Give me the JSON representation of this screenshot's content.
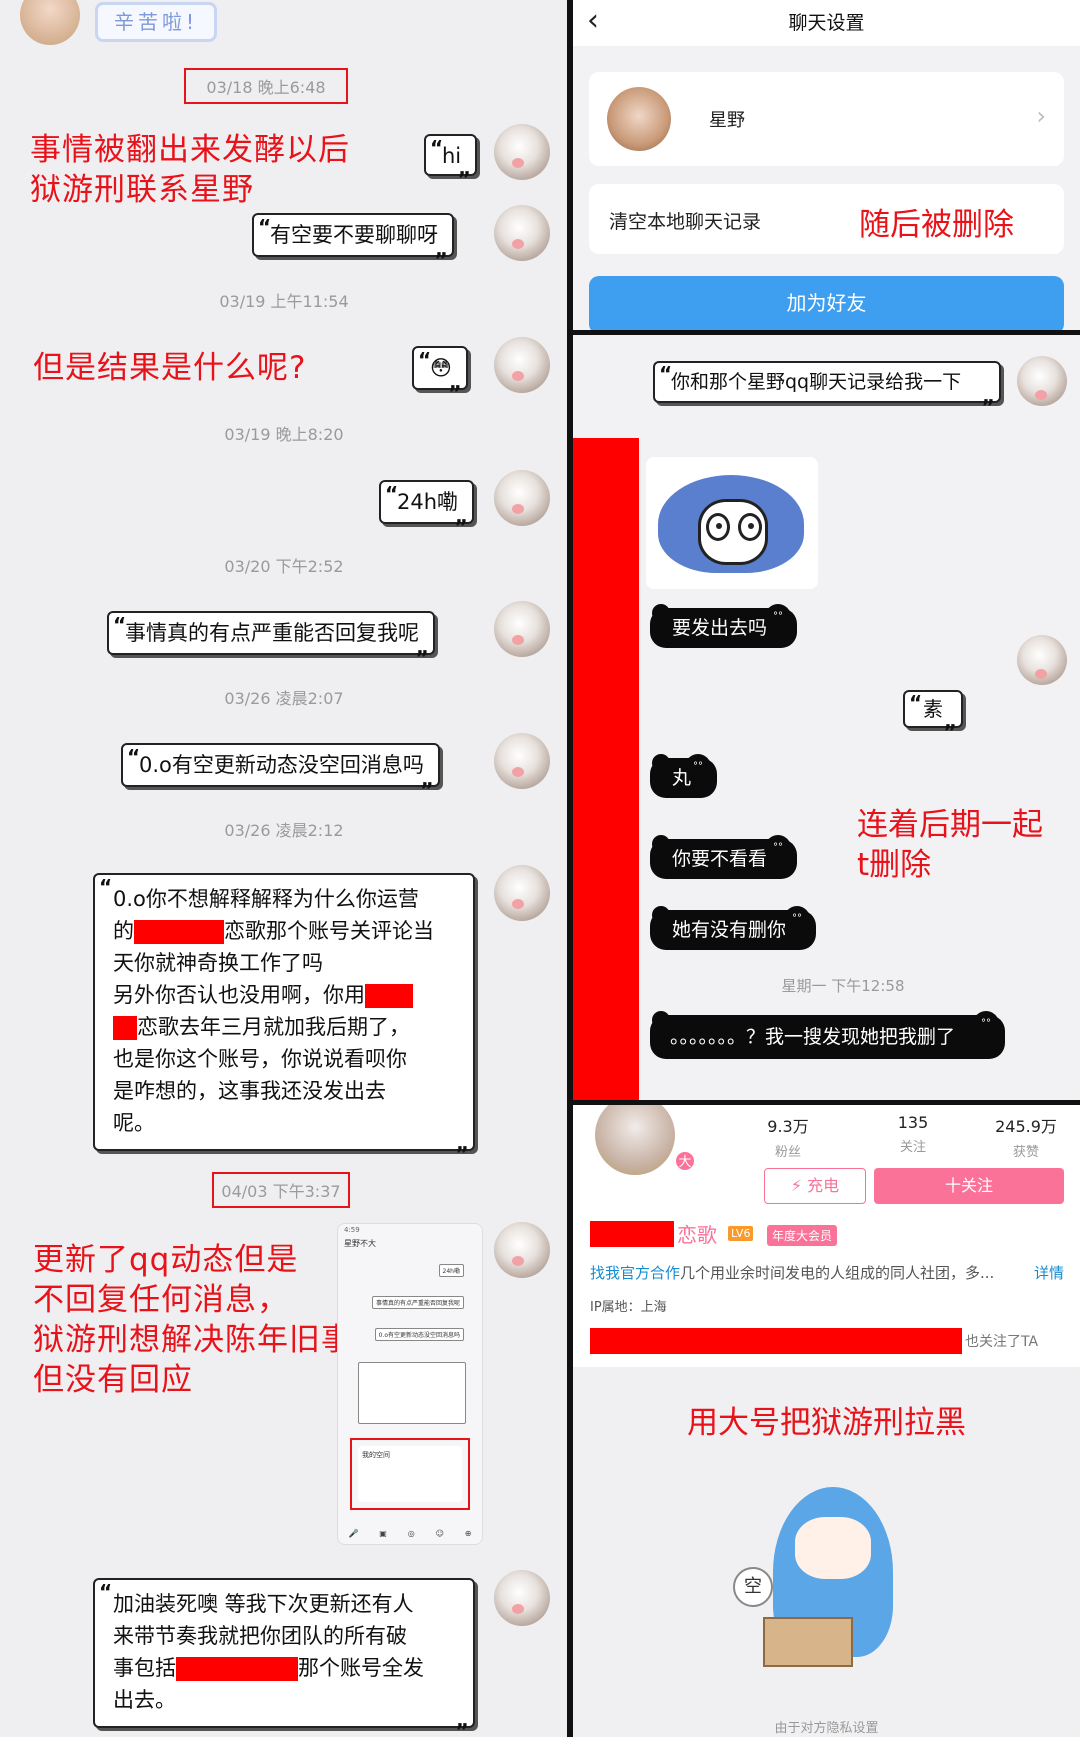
{
  "left": {
    "sticker_text": "辛苦啦!",
    "messages": [
      {
        "time": "03/18 晚上6:48",
        "bubbles": [
          "hi",
          "有空要不要聊聊呀"
        ],
        "note": "事情被翻出来发酵以后\n狱游刑联系星野"
      },
      {
        "time": "03/19 上午11:54",
        "bubbles": [
          "😳"
        ],
        "note": "但是结果是什么呢?"
      },
      {
        "time": "03/19 晚上8:20",
        "bubbles": [
          "24h嘞"
        ]
      },
      {
        "time": "03/20 下午2:52",
        "bubbles": [
          "事情真的有点严重能否回复我呢"
        ]
      },
      {
        "time": "03/26 凌晨2:07",
        "bubbles": [
          "0.o有空更新动态没空回消息吗"
        ]
      },
      {
        "time": "03/26 凌晨2:12",
        "long_bubble": {
          "line1": "0.o你不想解释解释为什么你运营",
          "line2a": "的",
          "line2b": "恋歌那个账号关评论当",
          "line3": "天你就神奇换工作了吗",
          "line4": "另外你否认也没用啊，你用",
          "line5": "恋歌去年三月就加我后期了，",
          "line6": "也是你这个账号，你说说看呗你",
          "line7": "是咋想的，这事我还没发出去",
          "line8": "呢。"
        }
      },
      {
        "time": "04/03 下午3:37",
        "note": "更新了qq动态但是\n不回复任何消息，\n狱游刑想解决陈年旧事\n但没有回应"
      }
    ],
    "last_bubble": {
      "line1": "加油装死噢 等我下次更新还有人",
      "line2": "来带节奏我就把你团队的所有破",
      "line3a": "事包括",
      "line3b": "那个账号全发",
      "line4": "出去。"
    },
    "mini_shot": {
      "status": "4:59",
      "title": "星野不大",
      "m1": "24h嘞",
      "m2": "事情真的有点严重能否回复我呢",
      "m3": "0.o有空更新动态没空回消息吗",
      "card": "我的空间"
    }
  },
  "settings": {
    "title": "聊天设置",
    "back_icon": "‹",
    "contact_name": "星野",
    "clear_history": "清空本地聊天记录",
    "annotation": "随后被删除",
    "add_friend": "加为好友"
  },
  "chat2": {
    "request": "你和那个星野qq聊天记录给我一下",
    "replies": [
      "要发出去吗",
      "丸",
      "你要不看看",
      "她有没有删你"
    ],
    "my_reply": "素",
    "time": "星期一 下午12:58",
    "last": "。。。。。。。？我一搜发现她把我删了",
    "annotation": "连着后期一起\nt删除"
  },
  "profile": {
    "fans": "9.3万",
    "fans_label": "粉丝",
    "following": "135",
    "following_label": "关注",
    "likes": "245.9万",
    "likes_label": "获赞",
    "charge": "⚡ 充电",
    "follow": "十关注",
    "name_suffix": "恋歌",
    "level": "LV6",
    "vip": "年度大会员",
    "sign_link": "找我官方合作",
    "sign_text": "几个用业余时间发电的人组成的同人社团，多...",
    "detail": "详情",
    "ip": "IP属地：上海",
    "mutual": "也关注了TA",
    "annotation": "用大号把狱游刑拉黑",
    "mascot_bubble": "空",
    "privacy": "由于对方隐私设置"
  },
  "colors": {
    "annotation_red": "#e8131a",
    "redaction": "#ff0000",
    "bili_pink": "#fb7299",
    "qq_blue": "#3e9ef0"
  }
}
